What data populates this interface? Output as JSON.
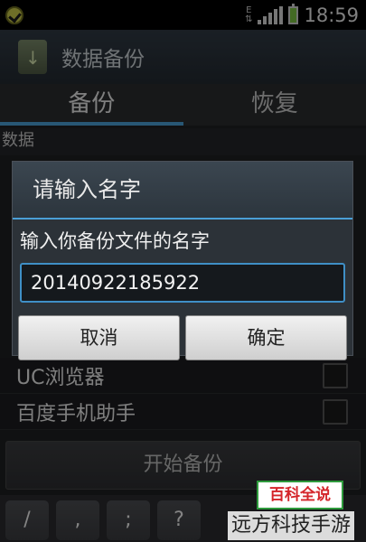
{
  "status_bar": {
    "time": "18:59",
    "network_label": "E",
    "icons": [
      "notification-icon",
      "data-arrows-icon",
      "signal-icon",
      "battery-icon"
    ]
  },
  "app": {
    "title": "数据备份",
    "icon": "sd-card-download-icon"
  },
  "tabs": [
    {
      "label": "备份",
      "active": true
    },
    {
      "label": "恢复",
      "active": false
    }
  ],
  "sections": {
    "data_header": "数据"
  },
  "list_items": [
    {
      "label": "UC浏览器",
      "checked": false
    },
    {
      "label": "百度手机助手",
      "checked": false
    }
  ],
  "start_button": "开始备份",
  "keyboard": {
    "keys": [
      "/",
      ",",
      ";",
      "?"
    ]
  },
  "dialog": {
    "title": "请输入名字",
    "message": "输入你备份文件的名字",
    "input_value": "20140922185922",
    "cancel_label": "取消",
    "confirm_label": "确定"
  },
  "watermark": {
    "badge": "百科全说",
    "text": "远方科技手游"
  },
  "colors": {
    "accent": "#4a9fd6",
    "background": "#1e1f21",
    "dialog_title_bg": "#3b4650"
  }
}
